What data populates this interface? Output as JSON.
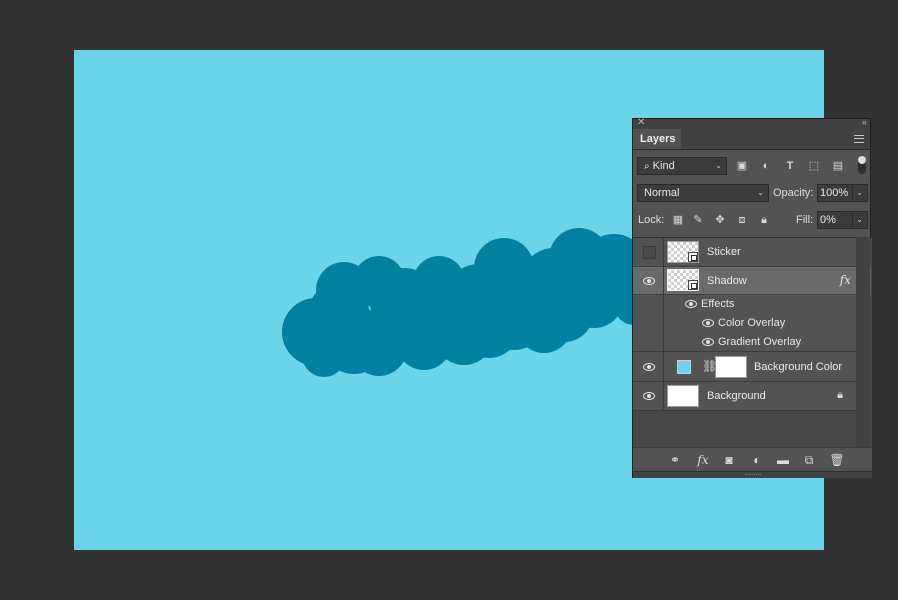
{
  "canvas": {
    "background": "#6ad4e9",
    "sticker_color": "#0280a0"
  },
  "panel": {
    "tab": "Layers",
    "close_glyph": "✕",
    "collapse_glyph": "‹‹",
    "filter": {
      "label": "Kind",
      "search_icon": "search-icon",
      "chevron": "⌄"
    },
    "blend_mode": "Normal",
    "opacity_label": "Opacity:",
    "opacity": "100%",
    "lock_label": "Lock:",
    "fill_label": "Fill:",
    "fill": "0%",
    "layers": [
      {
        "name": "Sticker",
        "visible": false,
        "thumb": "checker",
        "smart": true
      },
      {
        "name": "Shadow",
        "visible": true,
        "selected": true,
        "thumb": "checker",
        "smart": true,
        "fx": "fx"
      },
      {
        "name": "Background Color",
        "visible": true,
        "thumb": "solid",
        "mask": true
      },
      {
        "name": "Background",
        "visible": true,
        "thumb": "white",
        "locked": true
      }
    ],
    "effects": {
      "label": "Effects",
      "items": [
        "Color Overlay",
        "Gradient Overlay"
      ]
    },
    "footer_icons": [
      "link-icon",
      "fx-icon",
      "mask-icon",
      "adjustment-icon",
      "folder-icon",
      "new-layer-icon",
      "trash-icon"
    ]
  }
}
